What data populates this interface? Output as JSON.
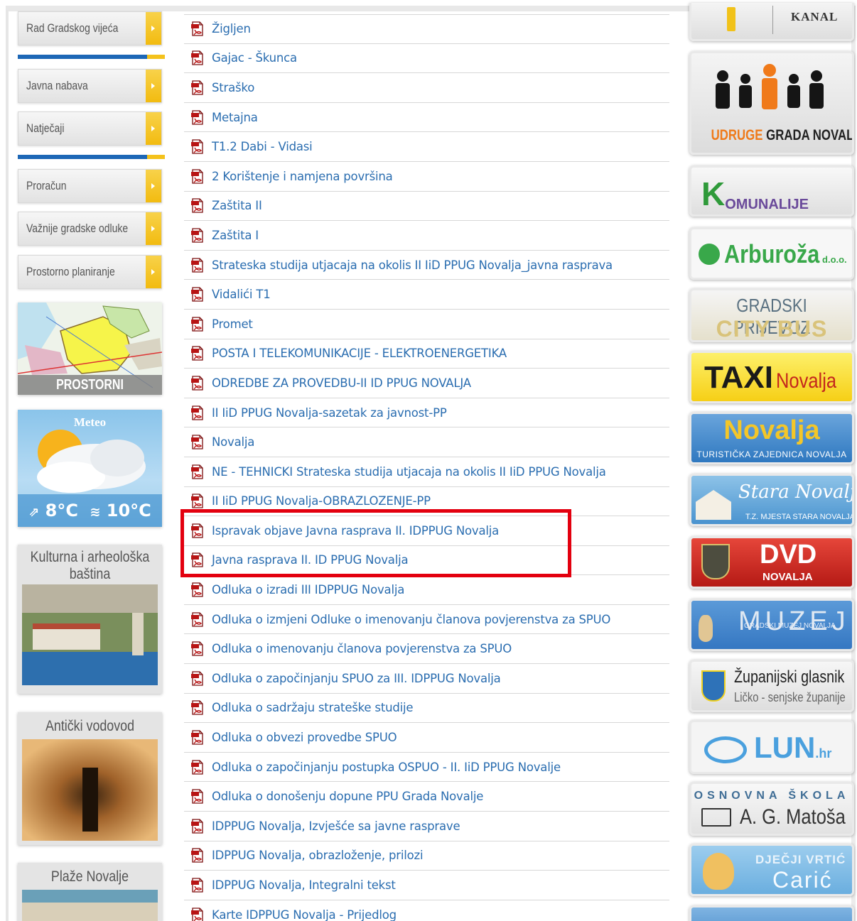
{
  "sidebar": {
    "menu": [
      {
        "label": "Rad Gradskog vijeća"
      },
      {
        "label": "Javna nabava"
      },
      {
        "label": "Natječaji"
      },
      {
        "label": "Proračun"
      },
      {
        "label": "Važnije gradske odluke"
      },
      {
        "label": "Prostorno planiranje"
      }
    ],
    "prostorni_caption": "PROSTORNI PLANOVI",
    "meteo": {
      "title": "Meteo",
      "temp_low": "8°C",
      "temp_high": "10°C"
    },
    "kultura_title": "Kulturna i arheološka baština",
    "anticki_title": "Antički vodovod",
    "plaze_title": "Plaže Novalje"
  },
  "documents": [
    "Žigljen",
    "Gajac - Škunca",
    "Straško",
    "Metajna",
    "T1.2 Dabi - Vidasi",
    "2 Korištenje i namjena površina",
    "Zaštita II",
    "Zaštita I",
    "Strateska studija utjacaja na okolis II IiD PPUG Novalja_javna rasprava",
    "Vidalići T1",
    "Promet",
    "POSTA I TELEKOMUNIKACIJE - ELEKTROENERGETIKA",
    "ODREDBE ZA PROVEDBU-II ID PPUG NOVALJA",
    "II IiD PPUG Novalja-sazetak za javnost-PP",
    "Novalja",
    "NE - TEHNICKI Strateska studija utjacaja na okolis II IiD PPUG Novalja",
    "II IiD PPUG Novalja-OBRAZLOZENJE-PP",
    "Ispravak objave Javna rasprava II. IDPPUG Novalja",
    "Javna rasprava II. ID PPUG Novalja",
    "Odluka o izradi III IDPPUG Novalja",
    "Odluka o izmjeni Odluke o imenovanju članova povjerenstva za SPUO",
    "Odluka o imenovanju članova povjerenstva za SPUO",
    "Odluka o započinjanju SPUO za III. IDPPUG Novalja",
    "Odluka o sadržaju strateške studije",
    "Odluka o obvezi provedbe SPUO",
    "Odluka o započinjanju postupka OSPUO - II. IiD PPUG Novalje",
    "Odluka o donošenju dopune PPU Grada Novalje",
    "IDPPUG Novalja, Izvješće sa javne rasprave",
    "IDPPUG Novalja, obrazloženje, prilozi",
    "IDPPUG Novalja, Integralni tekst",
    "Karte IDPPUG Novalja - Prijedlog"
  ],
  "banners": {
    "kanal": "KANAL",
    "udruge": {
      "part1": "UDRUGE",
      "part2": "GRADA NOVALJE"
    },
    "komunalije": {
      "k": "K",
      "rest": "OMUNALIJE"
    },
    "arburoza": {
      "name": "Arburoža",
      "suffix": "d.o.o."
    },
    "prijevoz": {
      "line1": "GRADSKI PRIJEVOZ",
      "line2": "CITY BUS"
    },
    "taxi": {
      "t1": "TAXI",
      "t2": "Novalja"
    },
    "tz": {
      "name": "Novalja",
      "sub": "TURISTIČKA ZAJEDNICA NOVALJA"
    },
    "stara": {
      "name": "Stara Novalja",
      "sub": "T.Z. MJESTA STARA NOVALJA"
    },
    "dvd": {
      "name": "DVD",
      "sub": "NOVALJA"
    },
    "muzej": {
      "name": "MUZEJ",
      "sub": "GRADSKI MUZEJ NOVALJA"
    },
    "glasnik": {
      "title": "Županijski glasnik",
      "sub": "Ličko - senjske županije"
    },
    "lun": {
      "name": "LUN",
      "suffix": ".hr"
    },
    "skola": {
      "line1": "OSNOVNA ŠKOLA",
      "line2": "A. G. Matoša"
    },
    "vrtic": {
      "line1": "DJEČJI VRTIĆ",
      "line2": "Carić"
    }
  },
  "colors": {
    "link": "#2a6db0",
    "highlight": "#e3000f",
    "menu_accent": "#f4c21c",
    "menu_sep_blue": "#1d67b6"
  }
}
